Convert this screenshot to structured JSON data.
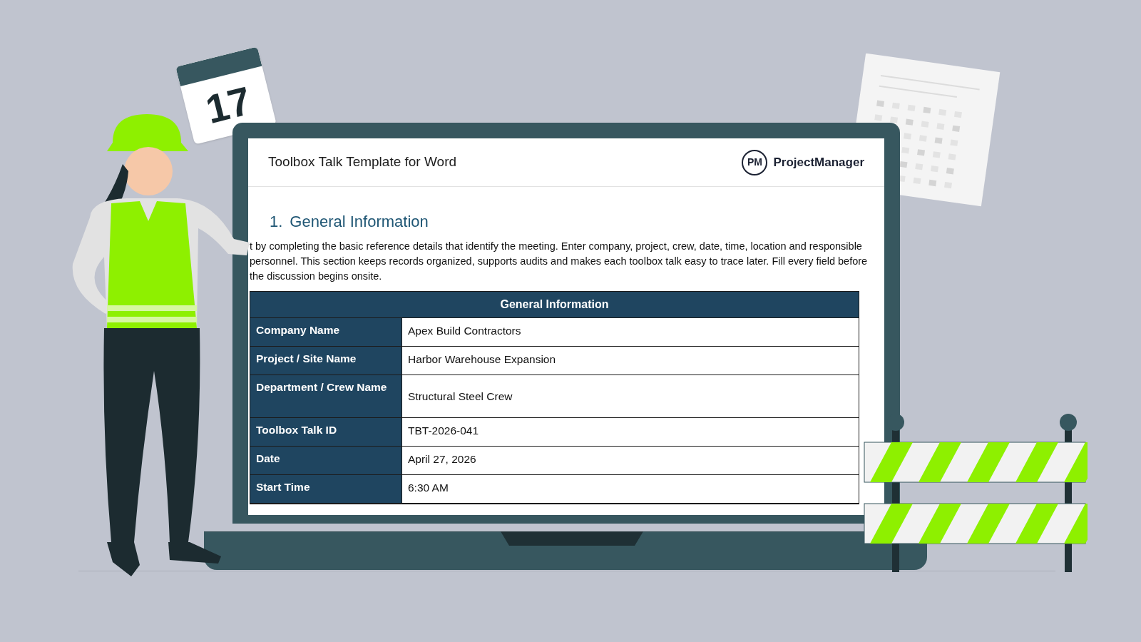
{
  "calendar": {
    "day": "17"
  },
  "document": {
    "title": "Toolbox Talk Template for Word",
    "brand": {
      "mark": "PM",
      "name": "ProjectManager"
    },
    "section": {
      "number": "1.",
      "heading": "General Information"
    },
    "intro": "t by completing the basic reference details that identify the meeting. Enter company, project, crew, date, time, location and responsible personnel. This section keeps records organized, supports audits and makes each toolbox talk easy to trace later. Fill every field before the discussion begins onsite.",
    "table": {
      "title": "General Information",
      "rows": [
        {
          "label": "Company Name",
          "value": "Apex Build Contractors"
        },
        {
          "label": "Project / Site Name",
          "value": "Harbor Warehouse Expansion"
        },
        {
          "label": "Department / Crew Name",
          "value": "Structural Steel Crew"
        },
        {
          "label": "Toolbox Talk ID",
          "value": "TBT-2026-041"
        },
        {
          "label": "Date",
          "value": "April 27, 2026"
        },
        {
          "label": "Start Time",
          "value": "6:30 AM"
        }
      ]
    }
  }
}
